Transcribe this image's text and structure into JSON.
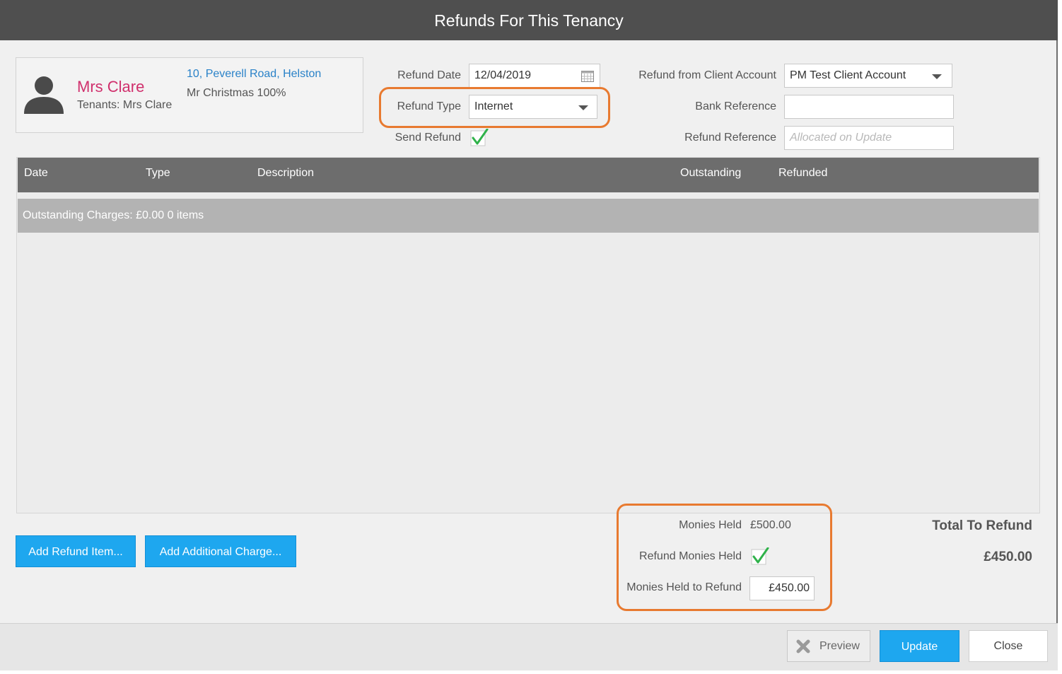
{
  "dialog": {
    "title": "Refunds For This Tenancy"
  },
  "tenant": {
    "name": "Mrs Clare",
    "tenants_line": "Tenants: Mrs Clare",
    "address": "10, Peverell Road, Helston",
    "landlord_line": "Mr Christmas 100%",
    "avatar_icon": "person-silhouette-icon"
  },
  "form": {
    "refund_date_label": "Refund Date",
    "refund_date_value": "12/04/2019",
    "refund_type_label": "Refund Type",
    "refund_type_value": "Internet",
    "send_refund_label": "Send Refund",
    "send_refund_checked": true,
    "client_account_label": "Refund from Client Account",
    "client_account_value": "PM Test Client Account",
    "bank_reference_label": "Bank Reference",
    "bank_reference_value": "",
    "refund_reference_label": "Refund Reference",
    "refund_reference_placeholder": "Allocated on Update"
  },
  "grid": {
    "columns": [
      "Date",
      "Type",
      "Description",
      "Outstanding",
      "Refunded"
    ],
    "group_label": "Outstanding Charges: £0.00 0 items",
    "rows": []
  },
  "actions": {
    "add_refund_item": "Add Refund Item...",
    "add_additional_charge": "Add Additional Charge..."
  },
  "monies": {
    "held_label": "Monies Held",
    "held_value": "£500.00",
    "refund_held_label": "Refund Monies Held",
    "refund_held_checked": true,
    "to_refund_label": "Monies Held to Refund",
    "to_refund_value": "£450.00"
  },
  "totals": {
    "label": "Total To Refund",
    "value": "£450.00"
  },
  "footer": {
    "preview": "Preview",
    "update": "Update",
    "close": "Close"
  },
  "colors": {
    "accent": "#1ea7ef",
    "highlight": "#e87a30",
    "tenant_name": "#d0306d",
    "link": "#2a82c8",
    "title_bar": "#4f4f4f"
  }
}
